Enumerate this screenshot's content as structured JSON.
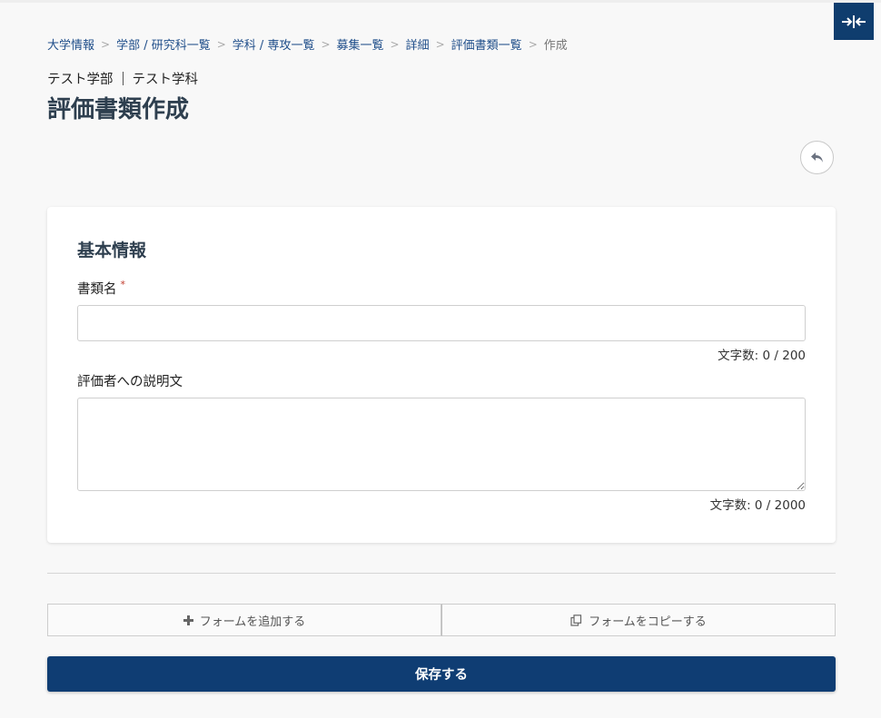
{
  "breadcrumb": {
    "items": [
      "大学情報",
      "学部 / 研究科一覧",
      "学科 / 専攻一覧",
      "募集一覧",
      "詳細",
      "評価書類一覧"
    ],
    "current": "作成",
    "separator": ">"
  },
  "header": {
    "faculty": "テスト学部",
    "department": "テスト学科",
    "title": "評価書類作成"
  },
  "basic_info": {
    "section_title": "基本情報",
    "document_name": {
      "label": "書類名",
      "required_mark": "*",
      "value": "",
      "counter": "文字数: 0 / 200"
    },
    "evaluator_description": {
      "label": "評価者への説明文",
      "value": "",
      "counter": "文字数: 0 / 2000"
    }
  },
  "actions": {
    "add_form_label": "フォームを追加する",
    "copy_form_label": "フォームをコピーする",
    "save_label": "保存する"
  },
  "icons": {
    "collapse": "collapse-horizontal-icon",
    "back": "reply-arrow-icon",
    "add": "plus-icon",
    "copy": "copy-icon"
  },
  "colors": {
    "primary": "#0f3d73",
    "link": "#1f4e8a",
    "title": "#2e3f4f",
    "required": "#c0392b"
  }
}
